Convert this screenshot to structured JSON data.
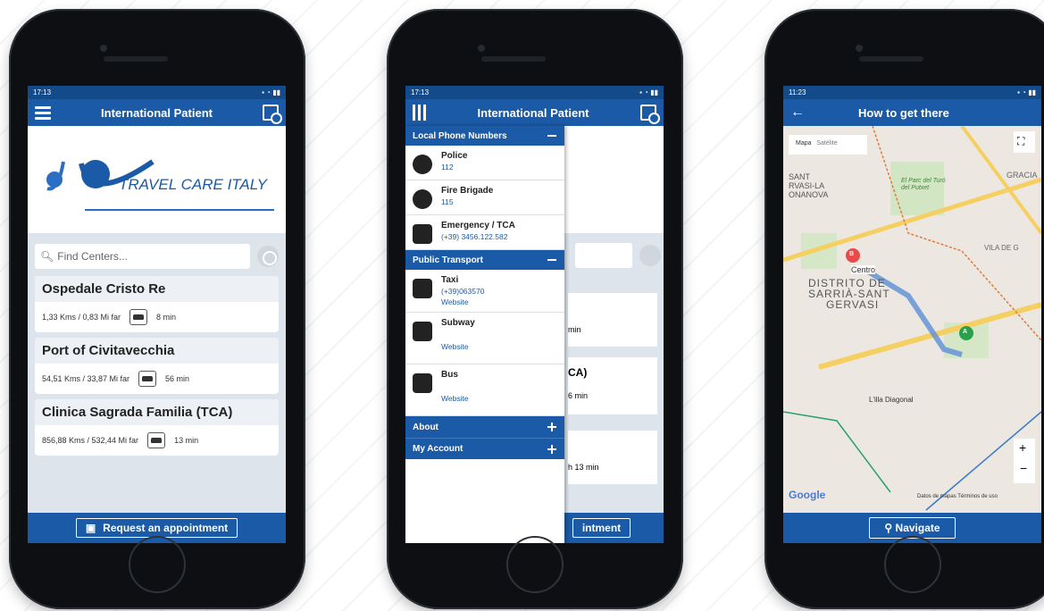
{
  "phone1": {
    "status_time": "17:13",
    "app_title": "International Patient",
    "logo_text": "TRAVEL CARE ITALY",
    "search_placeholder": "Find Centers...",
    "centers": [
      {
        "name": "Ospedale Cristo Re",
        "distance": "1,33 Kms / 0,83 Mi far",
        "time": "8 min"
      },
      {
        "name": "Port of Civitavecchia",
        "distance": "54,51 Kms / 33,87 Mi far",
        "time": "56 min"
      },
      {
        "name": "Clinica Sagrada Familia (TCA)",
        "distance": "856,88 Kms / 532,44 Mi far",
        "time": "13 min"
      }
    ],
    "appointment_button": "Request an appointment"
  },
  "phone2": {
    "status_time": "17:13",
    "app_title": "International Patient",
    "sections": {
      "local_phone": "Local Phone Numbers",
      "public_transport": "Public Transport",
      "about": "About",
      "my_account": "My Account"
    },
    "phone_items": [
      {
        "title": "Police",
        "number": "112",
        "icon": "police-icon"
      },
      {
        "title": "Fire Brigade",
        "number": "115",
        "icon": "firefighter-icon"
      },
      {
        "title": "Emergency / TCA",
        "number": "(+39) 3456.122.582",
        "icon": "heartbeat-icon"
      }
    ],
    "transport_items": [
      {
        "title": "Taxi",
        "number": "(+39)063570",
        "link": "Website",
        "icon": "taxi-icon"
      },
      {
        "title": "Subway",
        "number": "",
        "link": "Website",
        "icon": "subway-icon"
      },
      {
        "title": "Bus",
        "number": "",
        "link": "Website",
        "icon": "bus-icon"
      }
    ],
    "partial_texts": {
      "min1": "min",
      "ca": "CA)",
      "min2": "6 min",
      "min3": "h 13 min",
      "appointment": "intment"
    }
  },
  "phone3": {
    "status_time": "11:23",
    "title": "How to get there",
    "map_toggle": {
      "map": "Mapa",
      "satellite": "Satélite"
    },
    "map_labels": {
      "district1": "DISTRITO DE",
      "district2": "SARRIÀ-SANT",
      "district3": "GERVASI",
      "sant": "SANT",
      "gervasi": "RVASI-LA",
      "bonanova": "ONANOVA",
      "gracia": "GRACIA",
      "vila": "VILA DE G",
      "centro": "Centro",
      "illa": "L'illa Diagonal",
      "google": "Google",
      "terms": "Datos de mapas   Términos de uso",
      "parc": "El Parc del Turó del Putxet",
      "marker_b": "B",
      "marker_a": "A"
    },
    "navigate_button": "Navigate"
  },
  "colors": {
    "primary": "#1b5aa6",
    "status": "#134a8a"
  }
}
